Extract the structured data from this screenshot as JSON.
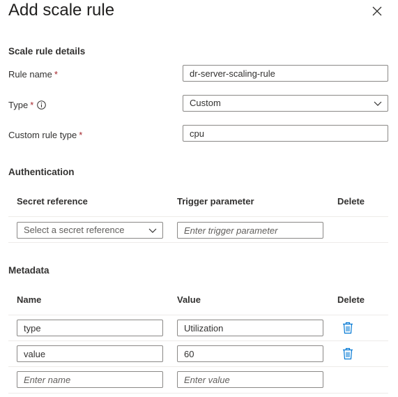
{
  "header": {
    "title": "Add scale rule"
  },
  "details": {
    "section_title": "Scale rule details",
    "rule_name": {
      "label": "Rule name",
      "required": "*",
      "value": "dr-server-scaling-rule"
    },
    "type": {
      "label": "Type",
      "required": "*",
      "value": "Custom"
    },
    "custom_rule_type": {
      "label": "Custom rule type",
      "required": "*",
      "value": "cpu"
    }
  },
  "authentication": {
    "section_title": "Authentication",
    "columns": [
      "Secret reference",
      "Trigger parameter",
      "Delete"
    ],
    "row": {
      "secret_placeholder": "Select a secret reference",
      "trigger_placeholder": "Enter trigger parameter"
    }
  },
  "metadata": {
    "section_title": "Metadata",
    "columns": [
      "Name",
      "Value",
      "Delete"
    ],
    "rows": [
      {
        "name": "type",
        "value": "Utilization"
      },
      {
        "name": "value",
        "value": "60"
      }
    ],
    "new_row": {
      "name_placeholder": "Enter name",
      "value_placeholder": "Enter value"
    }
  },
  "icons": {
    "close": "close-icon",
    "info": "info-icon",
    "chevron": "chevron-down-icon",
    "delete": "trash-icon"
  },
  "colors": {
    "accent": "#0078d4",
    "required": "#a4262c",
    "border": "#8a8886"
  }
}
